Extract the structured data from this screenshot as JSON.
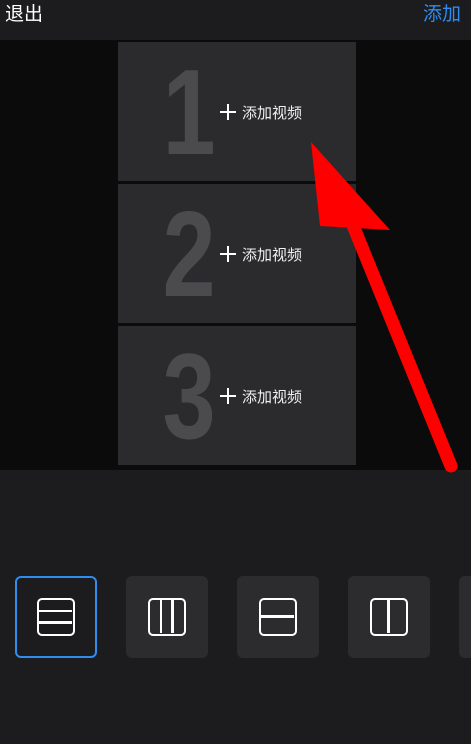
{
  "header": {
    "exit_label": "退出",
    "add_label": "添加"
  },
  "slots": [
    {
      "number": "1",
      "add_label": "添加视频"
    },
    {
      "number": "2",
      "add_label": "添加视频"
    },
    {
      "number": "3",
      "add_label": "添加视频"
    }
  ],
  "layouts": {
    "selected_index": 0,
    "items": [
      "three-row-layout-icon",
      "three-column-layout-icon",
      "two-row-layout-icon",
      "two-column-layout-icon"
    ]
  },
  "colors": {
    "accent": "#2f8cf0",
    "annotation_arrow": "#ff0000"
  }
}
